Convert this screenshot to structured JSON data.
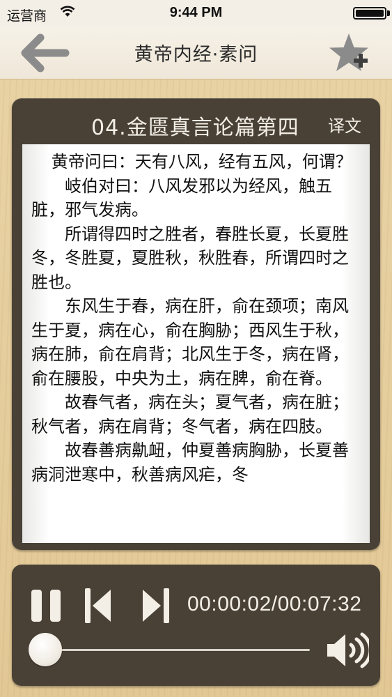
{
  "status_bar": {
    "carrier": "运营商",
    "time": "9:44 PM",
    "battery_level": 1.0
  },
  "nav": {
    "title": "黄帝内经·素问",
    "back_icon": "arrow-left-icon",
    "favorite_icon": "star-plus-icon"
  },
  "reader": {
    "chapter_title": "04.金匮真言论篇第四",
    "translate_label": "译文",
    "paragraphs": [
      "黄帝问曰：天有八风，经有五风，何谓？",
      "岐伯对曰：八风发邪以为经风，触五脏，邪气发病。",
      "所谓得四时之胜者，春胜长夏，长夏胜冬，冬胜夏，夏胜秋，秋胜春，所谓四时之胜也。",
      "东风生于春，病在肝，俞在颈项；南风生于夏，病在心，俞在胸胁；西风生于秋，病在肺，俞在肩背；北风生于冬，病在肾，俞在腰股，中央为土，病在脾，俞在脊。",
      "故春气者，病在头；夏气者，病在脏；秋气者，病在肩背；冬气者，病在四肢。",
      "故春善病鼽衄，仲夏善病胸胁，长夏善病洞泄寒中，秋善病风疟，冬"
    ]
  },
  "player": {
    "time_display": "00:00:02/00:07:32",
    "progress": 0.0044,
    "pause_icon": "pause-icon",
    "prev_icon": "skip-previous-icon",
    "next_icon": "skip-next-icon",
    "volume_icon": "volume-icon"
  },
  "colors": {
    "panel": "#4a4136",
    "wood": "#e6cc9a",
    "nav_bg": "#f2ece1",
    "accent_light": "#f3efe7"
  }
}
